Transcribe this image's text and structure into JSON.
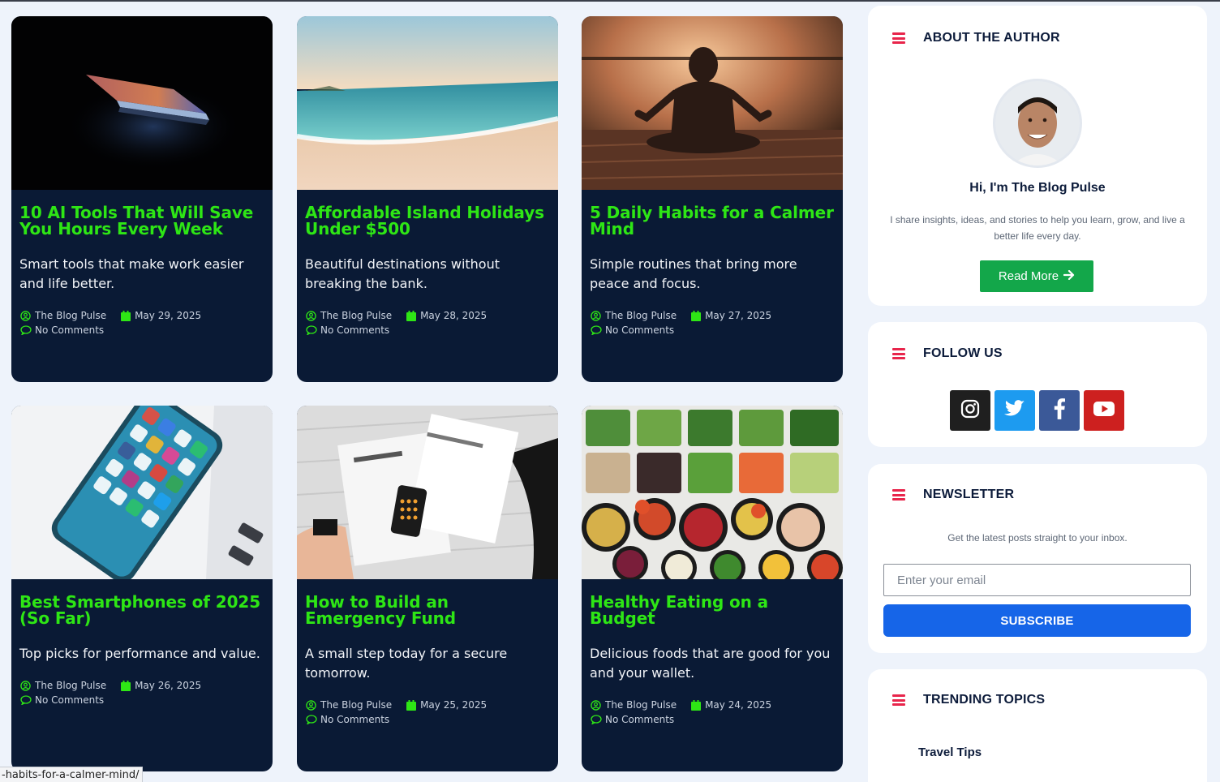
{
  "posts": [
    {
      "title": "10 AI Tools That Will Save You Hours Every Week",
      "excerpt": "Smart tools that make work easier and life better.",
      "author": "The Blog Pulse",
      "date": "May 29, 2025",
      "comments": "No Comments"
    },
    {
      "title": "Affordable Island Holidays Under $500",
      "excerpt": "Beautiful destinations without breaking the bank.",
      "author": "The Blog Pulse",
      "date": "May 28, 2025",
      "comments": "No Comments"
    },
    {
      "title": "5 Daily Habits for a Calmer Mind",
      "excerpt": "Simple routines that bring more peace and focus.",
      "author": "The Blog Pulse",
      "date": "May 27, 2025",
      "comments": "No Comments"
    },
    {
      "title": "Best Smartphones of 2025 (So Far)",
      "excerpt": "Top picks for performance and value.",
      "author": "The Blog Pulse",
      "date": "May 26, 2025",
      "comments": "No Comments"
    },
    {
      "title": "How to Build an Emergency Fund",
      "excerpt": "A small step today for a secure tomorrow.",
      "author": "The Blog Pulse",
      "date": "May 25, 2025",
      "comments": "No Comments"
    },
    {
      "title": "Healthy Eating on a Budget",
      "excerpt": "Delicious foods that are good for you and your wallet.",
      "author": "The Blog Pulse",
      "date": "May 24, 2025",
      "comments": "No Comments"
    }
  ],
  "about": {
    "heading": "ABOUT THE AUTHOR",
    "name": "Hi, I'm The Blog Pulse",
    "bio": "I share insights, ideas, and stories to help you learn, grow, and live a better life every day.",
    "read_more": "Read More"
  },
  "follow": {
    "heading": "FOLLOW US",
    "networks": [
      {
        "icon": "instagram-icon",
        "color": "#1f1f1f"
      },
      {
        "icon": "twitter-icon",
        "color": "#1d9bf0"
      },
      {
        "icon": "facebook-icon",
        "color": "#3b5998"
      },
      {
        "icon": "youtube-icon",
        "color": "#cd201f"
      }
    ]
  },
  "newsletter": {
    "heading": "NEWSLETTER",
    "desc": "Get the latest posts straight to your inbox.",
    "placeholder": "Enter your email",
    "button": "SUBSCRIBE"
  },
  "trending": {
    "heading": "TRENDING TOPICS",
    "items": [
      "Travel Tips"
    ]
  },
  "status_url": "-habits-for-a-calmer-mind/",
  "colors": {
    "card_bg": "#0a1a35",
    "title_green": "#2ee615",
    "accent_red": "#e8254b",
    "subscribe_blue": "#1665e8",
    "read_more_green": "#13a74a"
  }
}
